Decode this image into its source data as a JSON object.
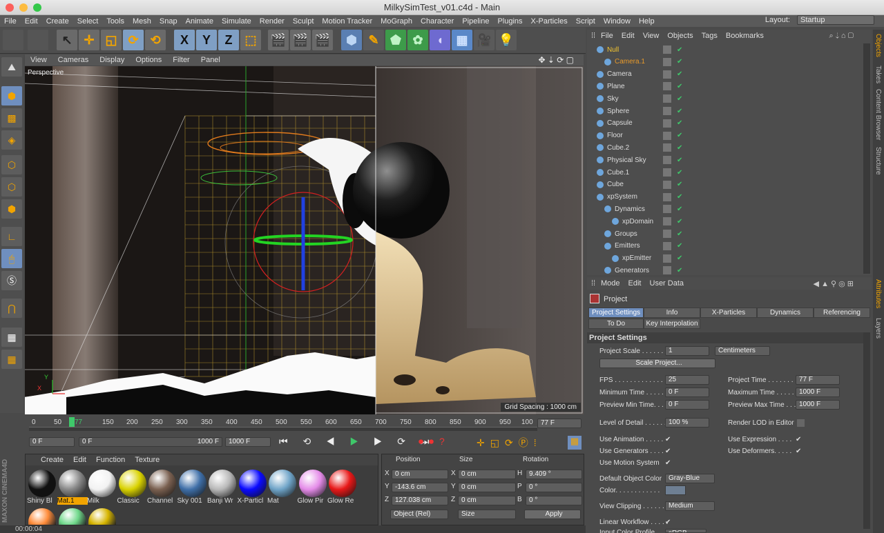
{
  "window": {
    "title": "MilkySimTest_v01.c4d - Main"
  },
  "menu": [
    "File",
    "Edit",
    "Create",
    "Select",
    "Tools",
    "Mesh",
    "Snap",
    "Animate",
    "Simulate",
    "Render",
    "Sculpt",
    "Motion Tracker",
    "MoGraph",
    "Character",
    "Pipeline",
    "Plugins",
    "X-Particles",
    "Script",
    "Window",
    "Help"
  ],
  "layout": {
    "label": "Layout:",
    "value": "Startup"
  },
  "toolbar": {
    "axis_x": "X",
    "axis_y": "Y",
    "axis_z": "Z"
  },
  "viewport": {
    "menu": [
      "View",
      "Cameras",
      "Display",
      "Options",
      "Filter",
      "Panel"
    ],
    "label": "Perspective",
    "grid_spacing": "Grid Spacing : 1000 cm",
    "axis_y": "Y",
    "axis_x": "X"
  },
  "timeline": {
    "ticks": [
      "0",
      "50",
      "100",
      "150",
      "200",
      "250",
      "300",
      "350",
      "400",
      "450",
      "500",
      "550",
      "600",
      "650",
      "700",
      "750",
      "800",
      "850",
      "900",
      "950",
      "100"
    ],
    "current_marker": "77",
    "current_frame": "77 F"
  },
  "transport": {
    "start": "0 F",
    "range_start": "0 F",
    "range_end": "1000 F",
    "end": "1000 F"
  },
  "materials": {
    "menu": [
      "Create",
      "Edit",
      "Function",
      "Texture"
    ],
    "items": [
      {
        "name": "Shiny Bl",
        "color": "#111"
      },
      {
        "name": "Mat.1",
        "color": "#888",
        "selected": true
      },
      {
        "name": "Milk",
        "color": "#f2f2f2"
      },
      {
        "name": "Classic",
        "color": "#d9d200"
      },
      {
        "name": "Channel",
        "color": "#7a6050"
      },
      {
        "name": "Sky 001",
        "color": "#3f6fa8"
      },
      {
        "name": "Banji Wr",
        "color": "#b8b8b8"
      },
      {
        "name": "X-Particl",
        "color": "#0a0aff"
      },
      {
        "name": "Mat",
        "color": "#6fa4c8"
      },
      {
        "name": "Glow Pir",
        "color": "#e48be8"
      },
      {
        "name": "Glow Re",
        "color": "#e81818"
      }
    ],
    "row2": [
      {
        "color": "#ff8c3a"
      },
      {
        "color": "#6fd88a"
      },
      {
        "color": "#d6b400"
      }
    ]
  },
  "coords": {
    "headers": [
      "Position",
      "Size",
      "Rotation"
    ],
    "rows": [
      {
        "a": "X",
        "pos": "0 cm",
        "b": "X",
        "size": "0 cm",
        "c": "H",
        "rot": "9.409 °"
      },
      {
        "a": "Y",
        "pos": "-143.6 cm",
        "b": "Y",
        "size": "0 cm",
        "c": "P",
        "rot": "0 °"
      },
      {
        "a": "Z",
        "pos": "127.038 cm",
        "b": "Z",
        "size": "0 cm",
        "c": "B",
        "rot": "0 °"
      }
    ],
    "mode": "Object (Rel)",
    "size_mode": "Size",
    "apply": "Apply"
  },
  "status": {
    "time": "00:00:04"
  },
  "objects": {
    "menu": [
      "File",
      "Edit",
      "View",
      "Objects",
      "Tags",
      "Bookmarks"
    ],
    "items": [
      {
        "name": "Null",
        "color": "#f3c530"
      },
      {
        "name": "Camera.1",
        "color": "#e89a2a"
      },
      {
        "name": "Camera",
        "color": "#ddd"
      },
      {
        "name": "Plane",
        "color": "#ddd"
      },
      {
        "name": "Sky",
        "color": "#ddd"
      },
      {
        "name": "Sphere",
        "color": "#ddd"
      },
      {
        "name": "Capsule",
        "color": "#ddd"
      },
      {
        "name": "Floor",
        "color": "#ddd"
      },
      {
        "name": "Cube.2",
        "color": "#ddd"
      },
      {
        "name": "Physical Sky",
        "color": "#ddd"
      },
      {
        "name": "Cube.1",
        "color": "#ddd"
      },
      {
        "name": "Cube",
        "color": "#ddd"
      },
      {
        "name": "xpSystem",
        "color": "#ddd"
      },
      {
        "name": "Dynamics",
        "color": "#ddd"
      },
      {
        "name": "xpDomain",
        "color": "#ddd"
      },
      {
        "name": "Groups",
        "color": "#ddd"
      },
      {
        "name": "Emitters",
        "color": "#ddd"
      },
      {
        "name": "xpEmitter",
        "color": "#ddd"
      },
      {
        "name": "Generators",
        "color": "#ddd"
      }
    ]
  },
  "attributes": {
    "menu": [
      "Mode",
      "Edit",
      "User Data"
    ],
    "title": "Project",
    "tabs": [
      "Project Settings",
      "Info",
      "X-Particles",
      "Dynamics",
      "Referencing",
      "To Do",
      "Key Interpolation"
    ],
    "section": "Project Settings",
    "project_scale": {
      "label": "Project Scale . . . . . .",
      "value": "1",
      "unit": "Centimeters"
    },
    "scale_button": "Scale Project...",
    "fps": {
      "label": "FPS . . . . . . . . . . . . . .",
      "value": "25"
    },
    "project_time": {
      "label": "Project Time . . . . . . .",
      "value": "77 F"
    },
    "min_time": {
      "label": "Minimum Time . . . . . .",
      "value": "0 F"
    },
    "max_time": {
      "label": "Maximum Time . . . . .",
      "value": "1000 F"
    },
    "prev_min": {
      "label": "Preview Min Time. . . .",
      "value": "0 F"
    },
    "prev_max": {
      "label": "Preview Max Time . . .",
      "value": "1000 F"
    },
    "lod": {
      "label": "Level of Detail . . . . . .",
      "value": "100 %"
    },
    "render_lod": "Render LOD in Editor",
    "use_animation": "Use Animation . . . . .",
    "use_expression": "Use Expression . . . .",
    "use_generators": "Use Generators . . . .",
    "use_deformers": "Use Deformers. . . . .",
    "use_motion": "Use Motion System",
    "default_color": {
      "label": "Default Object Color",
      "value": "Gray-Blue"
    },
    "color": "Color. . . . . . . . . . . .",
    "view_clipping": {
      "label": "View Clipping . . . . . .",
      "value": "Medium"
    },
    "linear_workflow": "Linear Workflow . . . . .",
    "input_color": "Input Color Profile . . .",
    "input_color_value": "sRGB"
  },
  "side_tabs": [
    "Objects",
    "Takes",
    "Content Browser",
    "Structure",
    "Attributes",
    "Layers"
  ]
}
